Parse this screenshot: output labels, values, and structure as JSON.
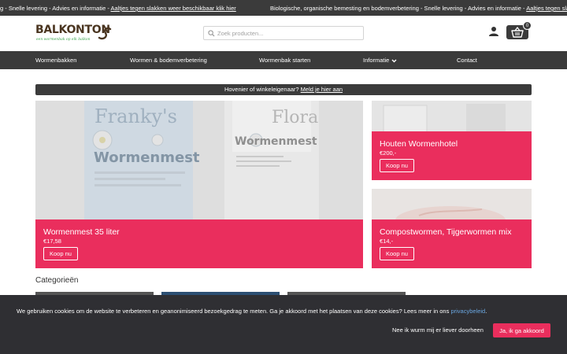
{
  "ticker": {
    "items": [
      {
        "text": "g - Snelle levering - Advies en informatie - ",
        "link": "Aaltjes tegen slakken weer beschikbaar klik hier"
      },
      {
        "text": "Biologische, organische bemesting en bodemverbetering - Snelle levering - Advies en informatie - ",
        "link": "Aaltjes tegen slakken"
      }
    ]
  },
  "header": {
    "logo_text": "BALKONTON",
    "logo_tagline": "een wormenbak op elk balkon",
    "search_placeholder": "Zoek producten...",
    "cart_count": "0"
  },
  "nav": {
    "items": [
      "Wormenbakken",
      "Wormen & bodemverbetering",
      "Wormenbak starten",
      "Informatie",
      "Contact"
    ]
  },
  "banner": {
    "text": "Hovenier of winkeleigenaar? ",
    "link": "Meld je hier aan"
  },
  "products": [
    {
      "title": "Wormenmest 35 liter",
      "price": "€17,58",
      "button": "Koop nu",
      "photo_text_1": "Franky's",
      "photo_text_2": "Flora",
      "photo_text_3": "Wormenmest"
    },
    {
      "title": "Houten Wormenhotel",
      "price": "€200,-",
      "button": "Koop nu"
    },
    {
      "title": "Compostwormen, Tijgerwormen mix",
      "price": "€14,-",
      "button": "Koop nu"
    }
  ],
  "categories": {
    "title": "Categorieën"
  },
  "cookie": {
    "text": "We gebruiken cookies om de website te verbeteren en geanonimiseerd bezoekgedrag te meten. Ga je akkoord met het plaatsen van deze cookies? Lees meer in ons ",
    "link": "privacybeleid",
    "suffix": ".",
    "decline": "Nee ik wurm mij er liever doorheen",
    "accept": "Ja, ik ga akkoord"
  },
  "colors": {
    "accent": "#ea2e5d",
    "dark": "#3b3b3b",
    "cookie_bg": "#2f2f33"
  }
}
